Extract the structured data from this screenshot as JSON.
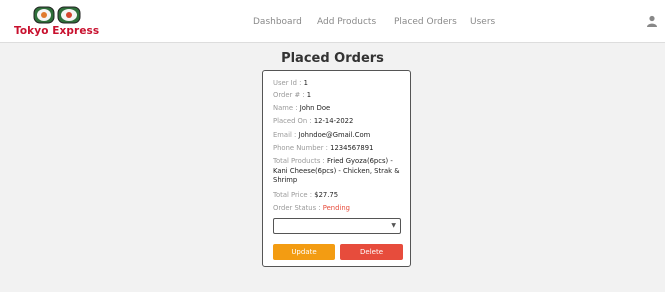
{
  "brand": {
    "name": "Tokyo Express"
  },
  "nav": {
    "items": [
      {
        "label": "Dashboard"
      },
      {
        "label": "Add Products"
      },
      {
        "label": "Placed Orders"
      },
      {
        "label": "Users"
      }
    ]
  },
  "user_icon": "user-icon",
  "page": {
    "title": "Placed Orders"
  },
  "order": {
    "user_id_label": "User Id :",
    "user_id": "1",
    "order_no_label": "Order # :",
    "order_no": "1",
    "name_label": "Name :",
    "name": "John Doe",
    "placed_on_label": "Placed On :",
    "placed_on": "12-14-2022",
    "email_label": "Email :",
    "email": "Johndoe@Gmail.Com",
    "phone_label": "Phone Number :",
    "phone": "1234567891",
    "products_label": "Total Products :",
    "products": "Fried Gyoza(6pcs) - Kani Cheese(6pcs) - Chicken, Strak & Shrimp",
    "price_label": "Total Price :",
    "price": "$27.75",
    "status_label": "Order Status :",
    "status": "Pending",
    "status_color": "#e74c3c",
    "status_select_value": ""
  },
  "actions": {
    "update_label": "Update",
    "delete_label": "Delete",
    "update_color": "#f39c12",
    "delete_color": "#e74c3c"
  }
}
